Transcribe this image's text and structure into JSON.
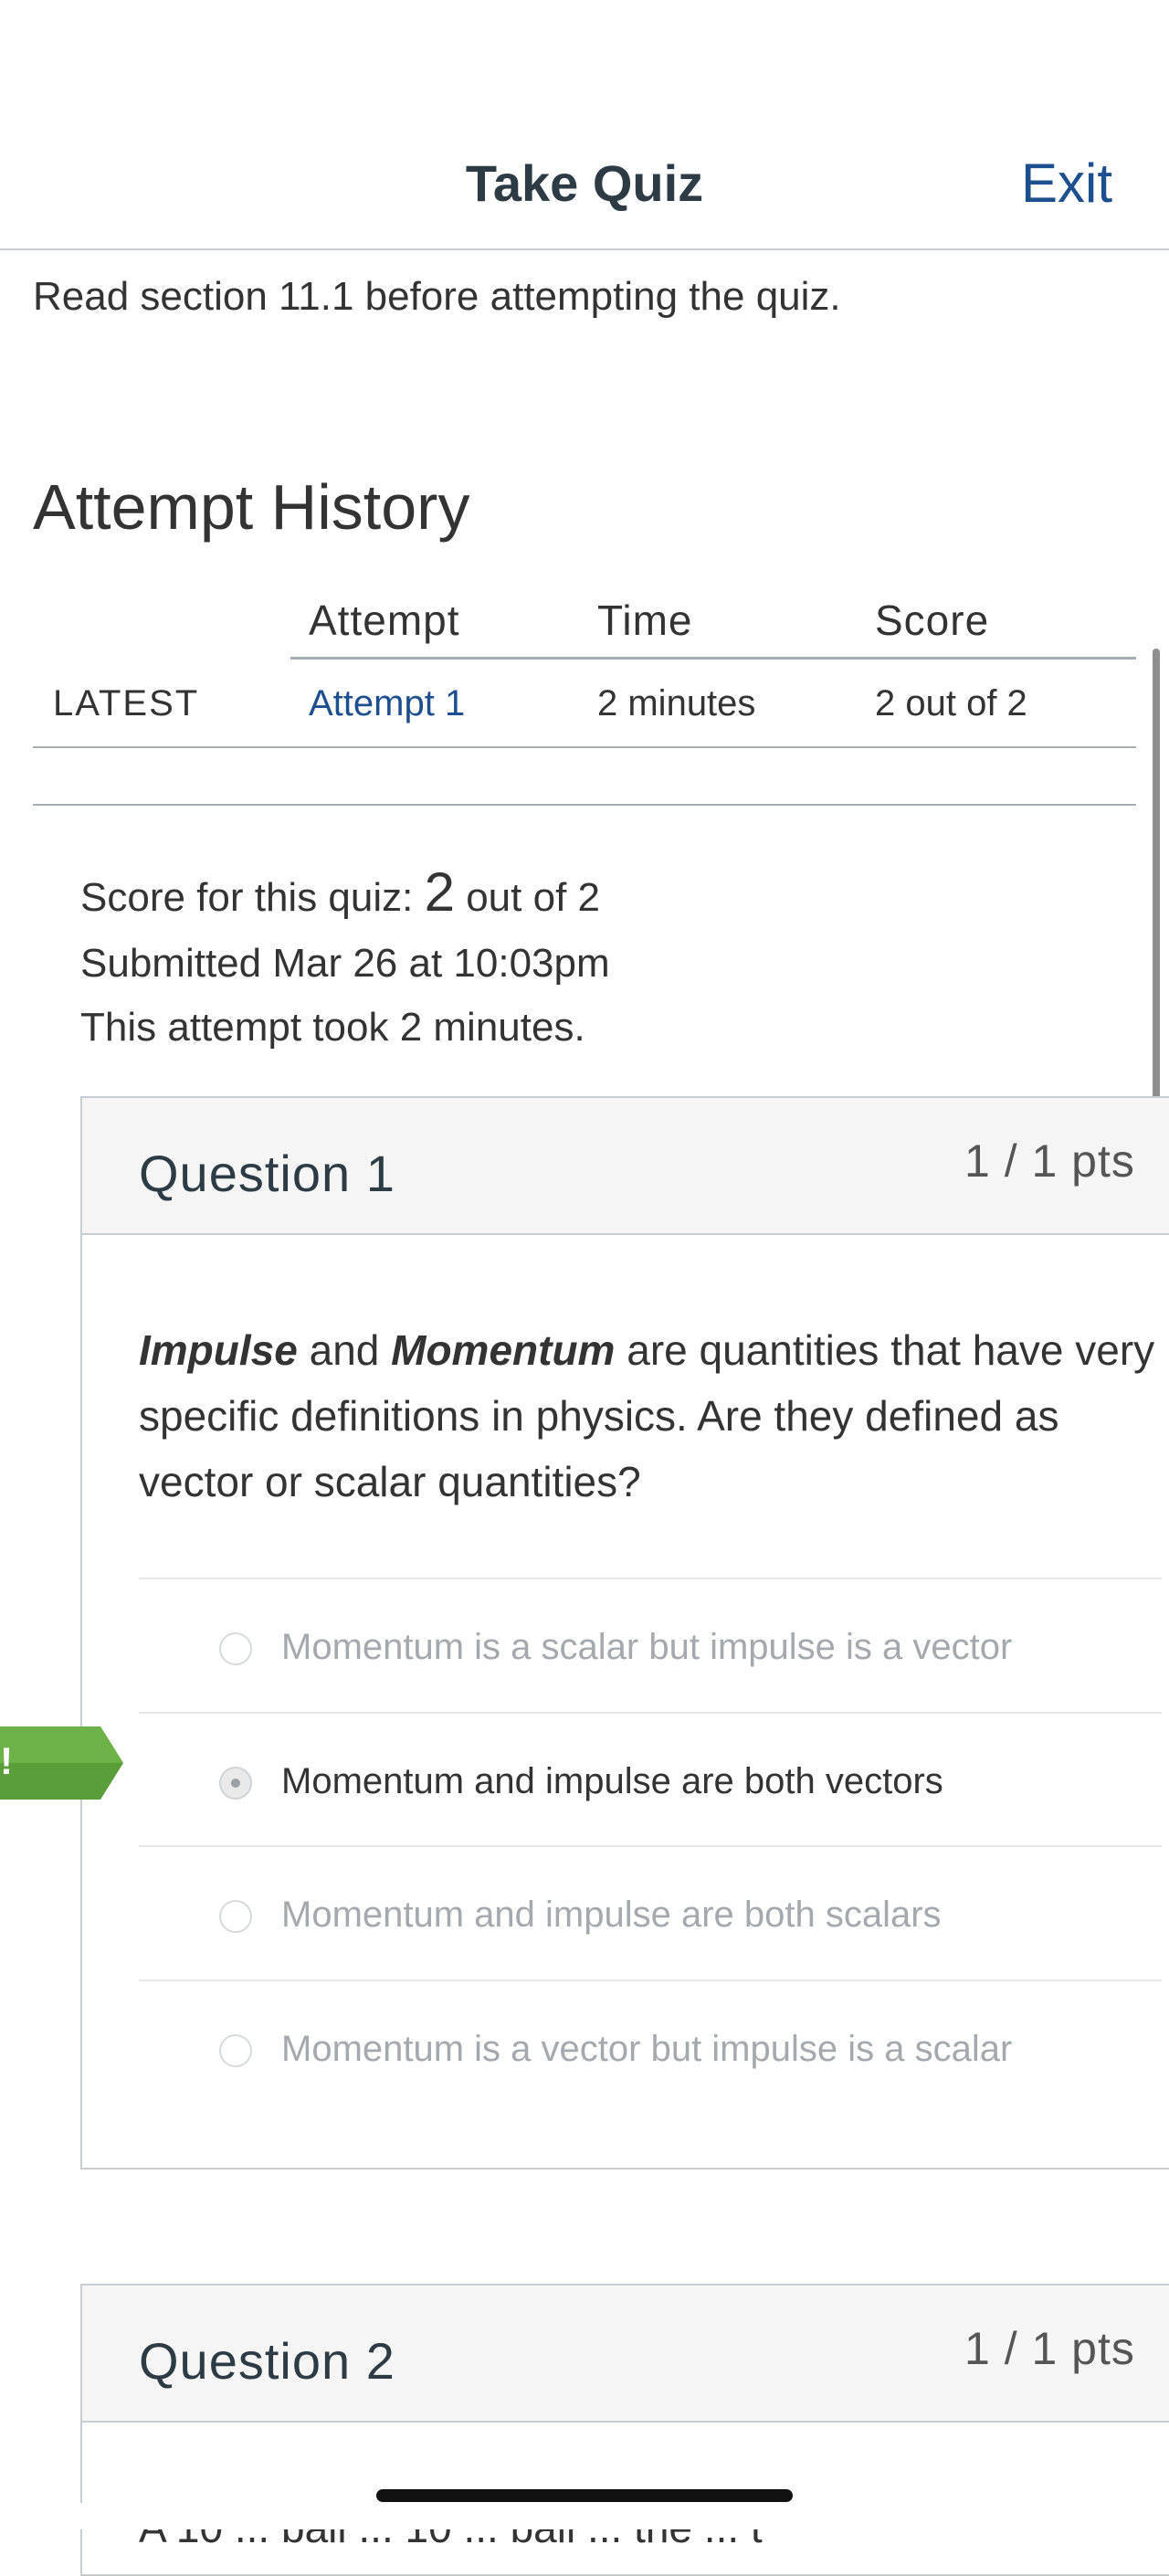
{
  "header": {
    "title": "Take Quiz",
    "exit_label": "Exit"
  },
  "intro_text": "Read section 11.1 before attempting the quiz.",
  "attempt_history": {
    "heading": "Attempt History",
    "columns": [
      "Attempt",
      "Time",
      "Score"
    ],
    "rows": [
      {
        "label": "LATEST",
        "attempt": "Attempt 1",
        "time": "2 minutes",
        "score": "2 out of 2"
      }
    ]
  },
  "summary": {
    "score_prefix": "Score for this quiz: ",
    "score_value": "2",
    "score_suffix": " out of 2",
    "submitted": "Submitted Mar 26 at 10:03pm",
    "duration": "This attempt took 2 minutes."
  },
  "questions": [
    {
      "title": "Question 1",
      "points": "1 / 1 pts",
      "text_parts": {
        "t1": "Impulse",
        "t2": " and ",
        "t3": "Momentum",
        "t4": " are quantities that have very specific definitions in physics. Are they defined as vector or scalar quantities?"
      },
      "answers": [
        {
          "text": "Momentum is a scalar but impulse is a vector",
          "selected": false
        },
        {
          "text": "Momentum and impulse are both vectors",
          "selected": true
        },
        {
          "text": "Momentum and impulse are both scalars",
          "selected": false
        },
        {
          "text": "Momentum is a vector but impulse is a scalar",
          "selected": false
        }
      ],
      "flag": {
        "visible_text": "!",
        "color": "#5a9e3a"
      }
    },
    {
      "title": "Question 2",
      "points": "1 / 1 pts",
      "partial_text": "A 10 ... ball ... 10 ... ball ... the ... t"
    }
  ],
  "colors": {
    "link": "#1d4f8e",
    "header_bg": "#f5f5f5",
    "border": "#c7cdd1",
    "correct_flag": "#5a9e3a"
  }
}
